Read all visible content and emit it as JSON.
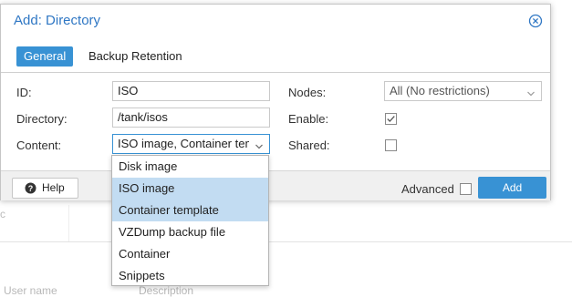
{
  "dialog": {
    "title": "Add: Directory",
    "tabs": [
      {
        "label": "General",
        "active": true
      },
      {
        "label": "Backup Retention",
        "active": false
      }
    ]
  },
  "form": {
    "id": {
      "label": "ID:",
      "value": "ISO"
    },
    "directory": {
      "label": "Directory:",
      "value": "/tank/isos"
    },
    "content": {
      "label": "Content:",
      "value": "ISO image, Container template"
    },
    "nodes": {
      "label": "Nodes:",
      "value": "All (No restrictions)"
    },
    "enable": {
      "label": "Enable:",
      "checked": true
    },
    "shared": {
      "label": "Shared:",
      "checked": false
    }
  },
  "content_options": [
    {
      "label": "Disk image",
      "selected": false
    },
    {
      "label": "ISO image",
      "selected": true
    },
    {
      "label": "Container template",
      "selected": true
    },
    {
      "label": "VZDump backup file",
      "selected": false
    },
    {
      "label": "Container",
      "selected": false
    },
    {
      "label": "Snippets",
      "selected": false
    }
  ],
  "footer": {
    "help_label": "Help",
    "advanced_label": "Advanced",
    "advanced_checked": false,
    "add_label": "Add"
  },
  "background": {
    "columns": [
      "User name",
      "Description"
    ],
    "tick": "c"
  },
  "colors": {
    "accent": "#3892d4",
    "title": "#2f77c4",
    "selected_option": "#c2dcf2"
  }
}
